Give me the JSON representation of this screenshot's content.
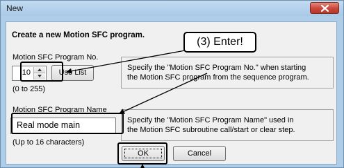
{
  "window": {
    "title": "New"
  },
  "dialog": {
    "heading": "Create a new Motion SFC program.",
    "program_no": {
      "label": "Motion SFC Program No.",
      "value": "10",
      "range": "(0 to 255)",
      "use_list_label": "Use List",
      "description_line1": "Specify the \"Motion SFC Program No.\" when starting",
      "description_line2": "the Motion SFC program from the sequence program."
    },
    "program_name": {
      "label": "Motion SFC Program Name",
      "value": "Real mode main",
      "limit": "(Up to 16 characters)",
      "description_line1": "Specify the \"Motion SFC Program Name\" used in",
      "description_line2": "the Motion SFC subroutine call/start or clear step."
    },
    "ok_label": "OK",
    "cancel_label": "Cancel"
  },
  "annotation": {
    "callout_text": "(3) Enter!"
  },
  "colors": {
    "title_bar": "#aecde8",
    "close_button": "#c9463a",
    "dialog_bg": "#f0f0f0",
    "annotation_stroke": "#000000"
  },
  "icons": {
    "close": "close-icon",
    "spin_up": "spin-up-icon",
    "spin_down": "spin-down-icon"
  }
}
